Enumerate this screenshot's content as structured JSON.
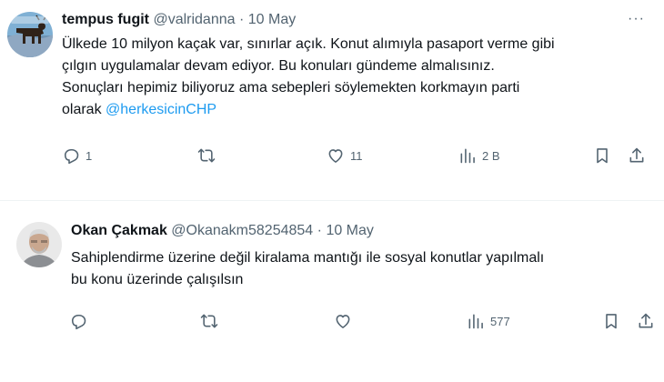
{
  "tweets": [
    {
      "name": "tempus fugit",
      "handle": "@valridanna",
      "sep": "·",
      "date": "10 May",
      "more": "···",
      "lines": [
        "Ülkede 10 milyon kaçak var, sınırlar açık. Konut alımıyla pasaport verme gibi",
        "çılgın uygulamalar devam ediyor. Bu konuları gündeme almalısınız.",
        "Sonuçları hepimiz biliyoruz ama sebepleri söylemekten korkmayın parti",
        "olarak "
      ],
      "mention": "@herkesicinCHP",
      "replies": "1",
      "reposts": "",
      "likes": "11",
      "views": "2 B"
    },
    {
      "name": "Okan Çakmak",
      "handle": "@Okanakm58254854",
      "sep": "·",
      "date": "10 May",
      "lines": [
        "Sahiplendirme üzerine değil kiralama mantığı ile sosyal konutlar yapılmalı",
        "bu konu üzerinde çalışılsın"
      ],
      "replies": "",
      "reposts": "",
      "likes": "",
      "views": "577"
    }
  ],
  "icons": {
    "reply": "reply-icon",
    "repost": "repost-icon",
    "like": "heart-icon",
    "views": "views-icon",
    "bookmark": "bookmark-icon",
    "share": "share-icon"
  },
  "colors": {
    "text": "#0f1419",
    "secondary": "#536471",
    "link": "#1d9bf0",
    "divider": "#eff3f4"
  }
}
